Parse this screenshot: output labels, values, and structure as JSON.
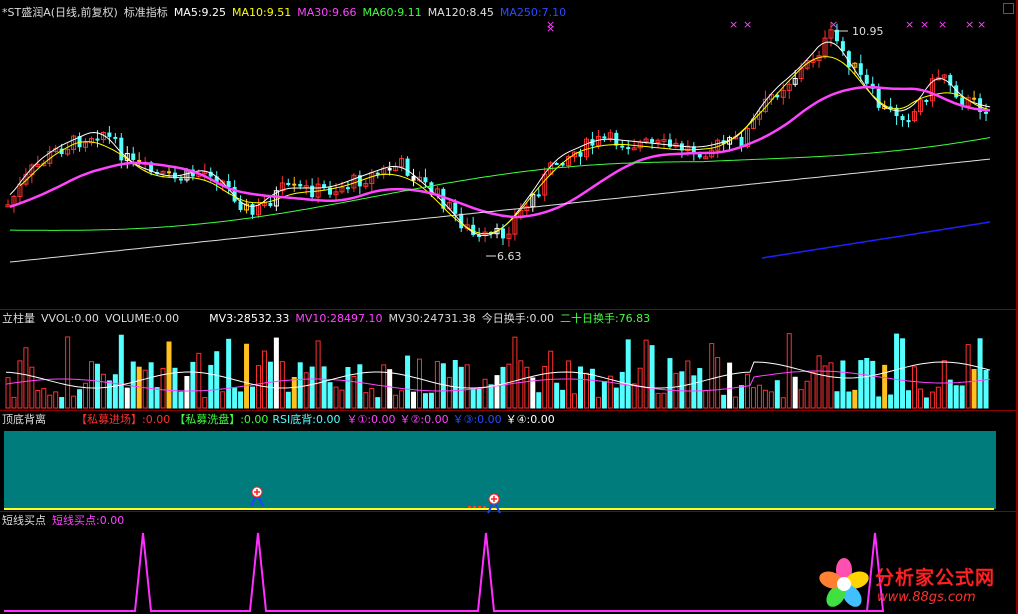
{
  "main_panel": {
    "stock_name": "*ST盛润A(日线,前复权)",
    "indicator": "标准指标",
    "ma5": "MA5:9.25",
    "ma10": "MA10:9.51",
    "ma30": "MA30:9.66",
    "ma60": "MA60:9.11",
    "ma120": "MA120:8.45",
    "ma250": "MA250:7.10",
    "high_label": "10.95",
    "low_label": "6.63",
    "colors": {
      "ma5": "#ffffff",
      "ma10": "#ffff00",
      "ma30": "#ff44ff",
      "ma60": "#40ff40",
      "ma120": "#e0e0e0",
      "ma250": "#2020ff",
      "up": "#ff3030",
      "down": "#54ffff"
    }
  },
  "volume_panel": {
    "name": "立柱量",
    "vvol": "VVOL:0.00",
    "volume": "VOLUME:0.00",
    "mv3": "MV3:28532.33",
    "mv10": "MV10:28497.10",
    "mv30": "MV30:24731.38",
    "today_turnover": "今日换手:0.00",
    "twenty_day_turnover": "二十日换手:76.83"
  },
  "divergence_panel": {
    "name": "顶底背离",
    "private_entry": "【私募进场】:0.00",
    "private_wash": "【私募洗盘】:0.00",
    "rsi_divergence": "RSI底背:0.00",
    "y1": "￥①:0.00",
    "y2": "￥②:0.00",
    "y3": "￥③:0.00",
    "y4": "￥④:0.00"
  },
  "short_panel": {
    "name": "短线买点",
    "value": "短线买点:0.00"
  },
  "watermark": {
    "title": "分析家公式网",
    "url": "www.88gs.com"
  }
}
